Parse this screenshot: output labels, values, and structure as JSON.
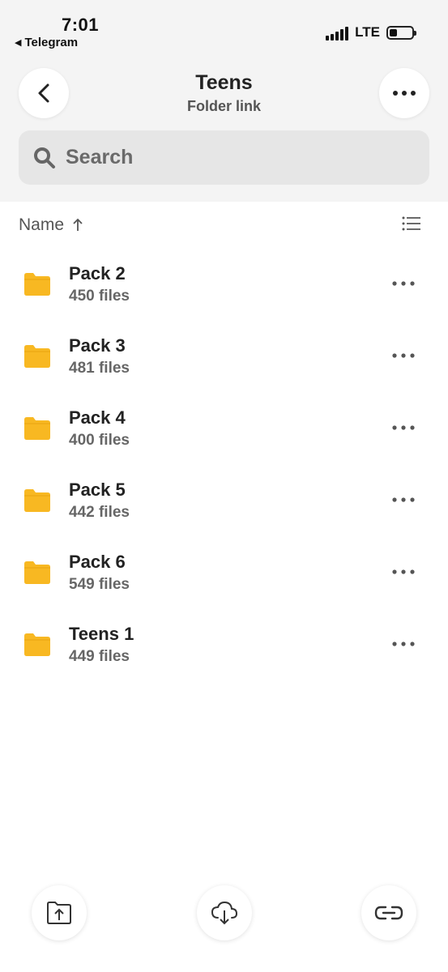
{
  "status_bar": {
    "time": "7:01",
    "back_app": "Telegram",
    "network": "LTE"
  },
  "header": {
    "title": "Teens",
    "subtitle": "Folder link"
  },
  "search": {
    "placeholder": "Search"
  },
  "sort": {
    "label": "Name",
    "direction_icon": "arrow-up-icon"
  },
  "folders": [
    {
      "name": "Pack 2",
      "count": "450 files"
    },
    {
      "name": "Pack 3",
      "count": "481 files"
    },
    {
      "name": "Pack 4",
      "count": "400 files"
    },
    {
      "name": "Pack 5",
      "count": "442 files"
    },
    {
      "name": "Pack 6",
      "count": "549 files"
    },
    {
      "name": "Teens 1",
      "count": "449 files"
    }
  ],
  "colors": {
    "folder": "#F8B822",
    "header_bg": "#F4F4F4",
    "search_bg": "#E6E6E6"
  }
}
